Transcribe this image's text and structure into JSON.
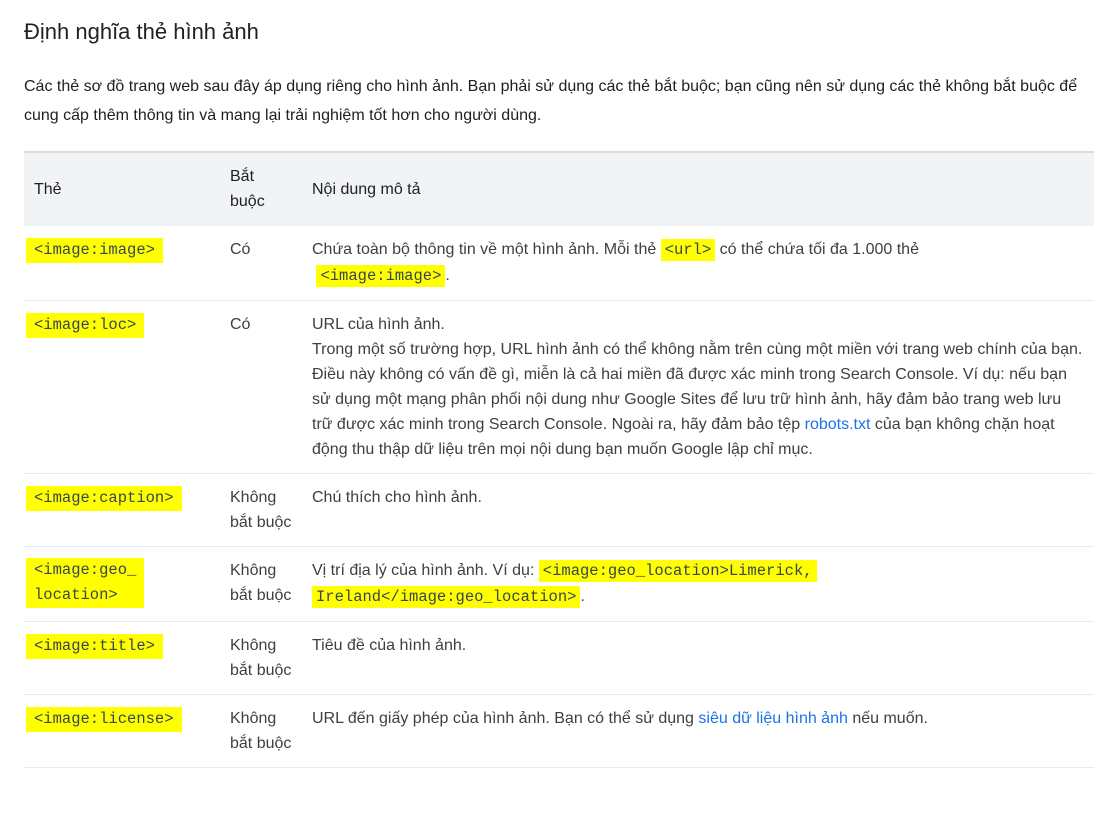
{
  "page": {
    "title": "Định nghĩa thẻ hình ảnh",
    "intro": "Các thẻ sơ đồ trang web sau đây áp dụng riêng cho hình ảnh. Bạn phải sử dụng các thẻ bắt buộc; bạn cũng nên sử dụng các thẻ không bắt buộc để cung cấp thêm thông tin và mang lại trải nghiệm tốt hơn cho người dùng."
  },
  "table": {
    "headers": {
      "tag": "Thẻ",
      "required": "Bắt buộc",
      "description": "Nội dung mô tả"
    },
    "rows": [
      {
        "tag": "<image:image>",
        "required": "Có",
        "desc_before": "Chứa toàn bộ thông tin về một hình ảnh. Mỗi thẻ ",
        "desc_code1": "<url>",
        "desc_middle": " có thể chứa tối đa 1.000 thẻ ",
        "desc_code2": "<image:image>",
        "desc_after": "."
      },
      {
        "tag": "<image:loc>",
        "required": "Có",
        "desc_line1": "URL của hình ảnh.",
        "desc_line2": "Trong một số trường hợp, URL hình ảnh có thể không nằm trên cùng một miền với trang web chính của bạn. Điều này không có vấn đề gì, miễn là cả hai miền đã được xác minh trong Search Console. Ví dụ: nếu bạn sử dụng một mạng phân phối nội dung như Google Sites để lưu trữ hình ảnh, hãy đảm bảo trang web lưu trữ được xác minh trong Search Console. Ngoài ra, hãy đảm bảo tệp ",
        "desc_link": "robots.txt",
        "desc_after": " của bạn không chặn hoạt động thu thập dữ liệu trên mọi nội dung bạn muốn Google lập chỉ mục."
      },
      {
        "tag": "<image:caption>",
        "required": "Không bắt buộc",
        "desc": "Chú thích cho hình ảnh."
      },
      {
        "tag_line1": "<image:geo_",
        "tag_line2": "location>",
        "required": "Không bắt buộc",
        "desc_before": "Vị trí địa lý của hình ảnh. Ví dụ: ",
        "desc_code": "<image:geo_location>Limerick, Ireland</image:geo_location>",
        "desc_after": "."
      },
      {
        "tag": "<image:title>",
        "required": "Không bắt buộc",
        "desc": "Tiêu đề của hình ảnh."
      },
      {
        "tag": "<image:license>",
        "required": "Không bắt buộc",
        "desc_before": "URL đến giấy phép của hình ảnh. Bạn có thể sử dụng ",
        "desc_link": "siêu dữ liệu hình ảnh",
        "desc_after": " nếu muốn."
      }
    ]
  },
  "colors": {
    "highlight": "#ffff00",
    "link": "#1a73e8",
    "header_bg": "#f1f3f4"
  }
}
